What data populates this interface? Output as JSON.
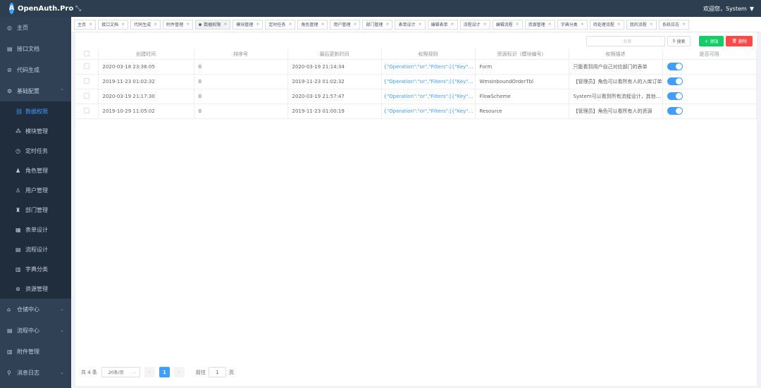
{
  "app": {
    "title": "OpenAuth.Pro",
    "logo_glyph": "A",
    "welcome": "欢迎您，System"
  },
  "sidebar": {
    "items": [
      {
        "label": "主页",
        "icon": "home-icon"
      },
      {
        "label": "接口文档",
        "icon": "doc-icon"
      },
      {
        "label": "代码生成",
        "icon": "code-icon"
      },
      {
        "label": "基础配置",
        "icon": "settings-icon",
        "expanded": true
      }
    ],
    "sub_items": [
      {
        "label": "数据权限",
        "icon": "data-permission-icon",
        "active": true
      },
      {
        "label": "模块管理",
        "icon": "module-icon"
      },
      {
        "label": "定时任务",
        "icon": "timer-icon"
      },
      {
        "label": "角色管理",
        "icon": "role-icon"
      },
      {
        "label": "用户管理",
        "icon": "user-icon"
      },
      {
        "label": "部门管理",
        "icon": "department-icon"
      },
      {
        "label": "表单设计",
        "icon": "form-icon"
      },
      {
        "label": "流程设计",
        "icon": "flow-icon"
      },
      {
        "label": "字典分类",
        "icon": "dictionary-icon"
      },
      {
        "label": "资源管理",
        "icon": "resource-icon"
      }
    ],
    "bottom_items": [
      {
        "label": "仓储中心",
        "icon": "warehouse-icon",
        "chevron": true
      },
      {
        "label": "流程中心",
        "icon": "workflow-icon",
        "chevron": true
      },
      {
        "label": "附件管理",
        "icon": "attachment-icon"
      },
      {
        "label": "消息日志",
        "icon": "message-icon",
        "chevron": true
      }
    ]
  },
  "tabs": [
    {
      "label": "主页"
    },
    {
      "label": "接口文档"
    },
    {
      "label": "代码生成"
    },
    {
      "label": "附件管理"
    },
    {
      "label": "数据权限",
      "current": true
    },
    {
      "label": "模块管理"
    },
    {
      "label": "定时任务"
    },
    {
      "label": "角色管理"
    },
    {
      "label": "用户管理"
    },
    {
      "label": "部门管理"
    },
    {
      "label": "表单设计"
    },
    {
      "label": "编辑表单"
    },
    {
      "label": "流程设计"
    },
    {
      "label": "编辑流程"
    },
    {
      "label": "资源管理"
    },
    {
      "label": "字典分类"
    },
    {
      "label": "待处理流程"
    },
    {
      "label": "我的流程"
    },
    {
      "label": "系统日志"
    }
  ],
  "toolbar": {
    "search_placeholder": "名称",
    "search_label": "搜索",
    "add_label": "添加",
    "delete_label": "删除"
  },
  "table": {
    "columns": [
      "创建时间",
      "排序号",
      "最后更新时间",
      "权限规则",
      "资源标识（模块编号）",
      "权限描述",
      "是否可用"
    ],
    "rows": [
      {
        "created": "2020-03-18 23:36:05",
        "sort": "0",
        "updated": "2020-03-19 21:14:34",
        "rule": "{\"Operation\":\"or\",\"Filters\":[{\"Key\":\"{loginOrg}\"",
        "resource": "Form",
        "desc": "只能看到用户自己对应部门的表单",
        "enabled": true
      },
      {
        "created": "2019-11-23 01:02:32",
        "sort": "0",
        "updated": "2019-11-23 01:02:32",
        "rule": "{\"Operation\":\"or\",\"Filters\":[{\"Key\":\"{loginRole}\"",
        "resource": "WmsInboundOrderTbl",
        "desc": "【管理员】角色可以看所有人的入库订单",
        "enabled": true
      },
      {
        "created": "2020-03-19 21:17:30",
        "sort": "0",
        "updated": "2020-03-19 21:57:47",
        "rule": "{\"Operation\":\"or\",\"Filters\":[{\"Key\":\"{loginRole}\"",
        "resource": "FlowScheme",
        "desc": "System可以看到所有流程设计，其他人只能看到自己的",
        "enabled": true
      },
      {
        "created": "2019-10-29 11:05:02",
        "sort": "0",
        "updated": "2019-11-23 01:00:19",
        "rule": "{\"Operation\":\"or\",\"Filters\":[{\"Key\":\"{loginRole}\"",
        "resource": "Resource",
        "desc": "【管理员】角色可以看所有人的资源",
        "enabled": true
      }
    ]
  },
  "pagination": {
    "total": "共 4 条",
    "page_size": "20条/页",
    "current_page": "1",
    "goto_label": "前往",
    "goto_value": "1",
    "page_unit": "页"
  }
}
